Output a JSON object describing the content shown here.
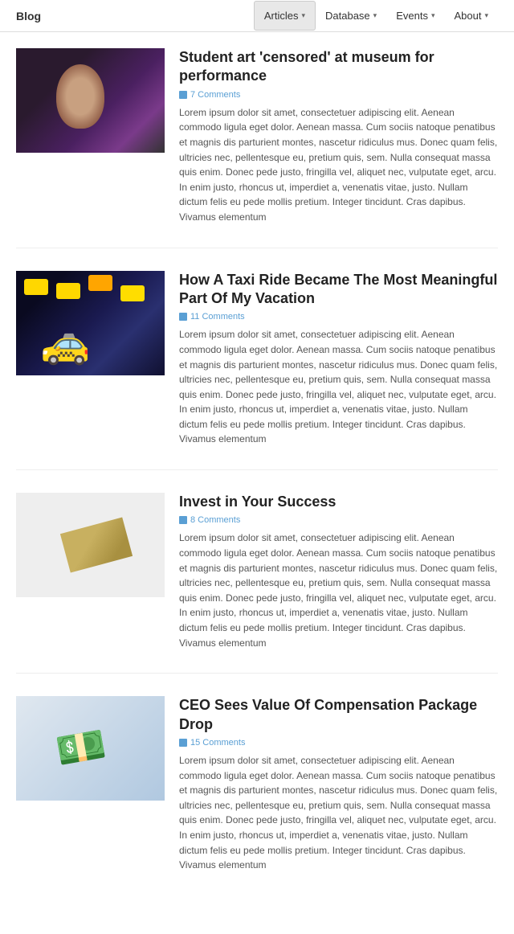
{
  "header": {
    "logo": "Blog",
    "nav": [
      {
        "label": "Articles",
        "active": true,
        "has_caret": true
      },
      {
        "label": "Database",
        "active": false,
        "has_caret": true
      },
      {
        "label": "Events",
        "active": false,
        "has_caret": true
      },
      {
        "label": "About",
        "active": false,
        "has_caret": true
      }
    ]
  },
  "articles": [
    {
      "id": 1,
      "title": "Student art 'censored' at museum for performance",
      "comments": "7 Comments",
      "has_image": true,
      "image_type": "art1",
      "body": "Lorem ipsum dolor sit amet, consectetuer adipiscing elit. Aenean commodo ligula eget dolor. Aenean massa. Cum sociis natoque penatibus et magnis dis parturient montes, nascetur ridiculus mus. Donec quam felis, ultricies nec, pellentesque eu, pretium quis, sem. Nulla consequat massa quis enim. Donec pede justo, fringilla vel, aliquet nec, vulputate eget, arcu. In enim justo, rhoncus ut, imperdiet a, venenatis vitae, justo. Nullam dictum felis eu pede mollis pretium. Integer tincidunt. Cras dapibus. Vivamus elementum"
    },
    {
      "id": 2,
      "title": "How A Taxi Ride Became The Most Meaningful Part Of My Vacation",
      "comments": "11 Comments",
      "has_image": true,
      "image_type": "art2",
      "body": "Lorem ipsum dolor sit amet, consectetuer adipiscing elit. Aenean commodo ligula eget dolor. Aenean massa. Cum sociis natoque penatibus et magnis dis parturient montes, nascetur ridiculus mus. Donec quam felis, ultricies nec, pellentesque eu, pretium quis, sem. Nulla consequat massa quis enim. Donec pede justo, fringilla vel, aliquet nec, vulputate eget, arcu. In enim justo, rhoncus ut, imperdiet a, venenatis vitae, justo. Nullam dictum felis eu pede mollis pretium. Integer tincidunt. Cras dapibus. Vivamus elementum"
    },
    {
      "id": 3,
      "title": "Invest in Your Success",
      "comments": "8 Comments",
      "has_image": true,
      "image_type": "art3",
      "body": "Lorem ipsum dolor sit amet, consectetuer adipiscing elit. Aenean commodo ligula eget dolor. Aenean massa. Cum sociis natoque penatibus et magnis dis parturient montes, nascetur ridiculus mus. Donec quam felis, ultricies nec, pellentesque eu, pretium quis, sem. Nulla consequat massa quis enim. Donec pede justo, fringilla vel, aliquet nec, vulputate eget, arcu. In enim justo, rhoncus ut, imperdiet a, venenatis vitae, justo. Nullam dictum felis eu pede mollis pretium. Integer tincidunt. Cras dapibus. Vivamus elementum"
    },
    {
      "id": 4,
      "title": "CEO Sees Value Of Compensation Package Drop",
      "comments": "15 Comments",
      "has_image": true,
      "image_type": "art4",
      "body": "Lorem ipsum dolor sit amet, consectetuer adipiscing elit. Aenean commodo ligula eget dolor. Aenean massa. Cum sociis natoque penatibus et magnis dis parturient montes, nascetur ridiculus mus. Donec quam felis, ultricies nec, pellentesque eu, pretium quis, sem. Nulla consequat massa quis enim. Donec pede justo, fringilla vel, aliquet nec, vulputate eget, arcu. In enim justo, rhoncus ut, imperdiet a, venenatis vitae, justo. Nullam dictum felis eu pede mollis pretium. Integer tincidunt. Cras dapibus. Vivamus elementum"
    }
  ]
}
